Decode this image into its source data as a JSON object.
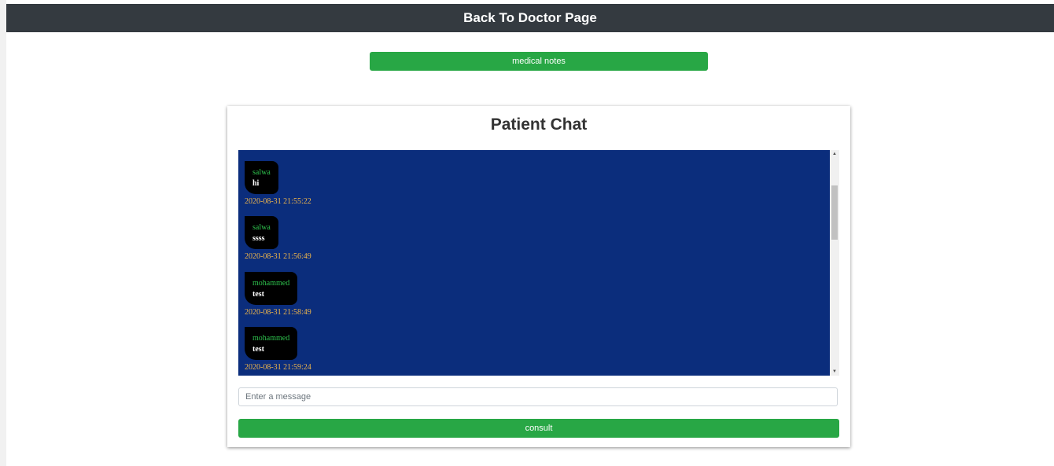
{
  "header": {
    "back_label": "Back To Doctor Page"
  },
  "toolbar": {
    "medical_notes_label": "medical notes"
  },
  "chat": {
    "title": "Patient Chat",
    "messages": [
      {
        "sender": "salwa",
        "text": "hi",
        "time": "2020-08-31 21:55:22"
      },
      {
        "sender": "salwa",
        "text": "ssss",
        "time": "2020-08-31 21:56:49"
      },
      {
        "sender": "mohammed",
        "text": "test",
        "time": "2020-08-31 21:58:49"
      },
      {
        "sender": "mohammed",
        "text": "test",
        "time": "2020-08-31 21:59:24"
      }
    ],
    "input_placeholder": "Enter a message",
    "consult_label": "consult"
  },
  "colors": {
    "topbar": "#343a40",
    "button_green": "#28a745",
    "chat_background": "#0b2d7c",
    "bubble": "#000000",
    "sender_text": "#2ec24d",
    "timestamp": "#f0b64a"
  }
}
